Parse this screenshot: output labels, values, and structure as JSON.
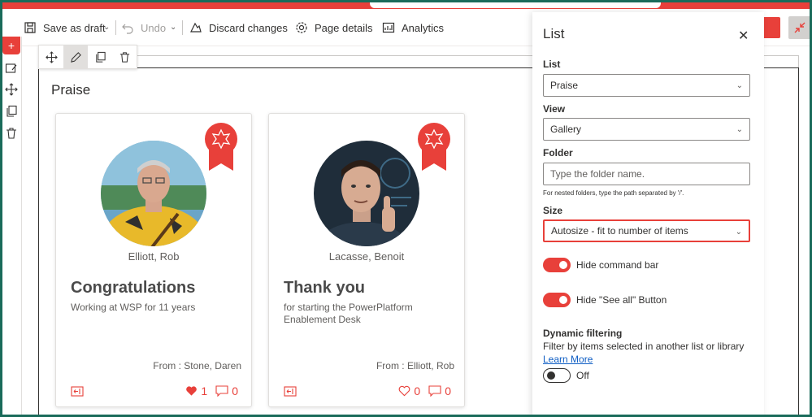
{
  "toolbar": {
    "save_draft": "Save as draft",
    "undo": "Undo",
    "discard": "Discard changes",
    "page_details": "Page details",
    "analytics": "Analytics"
  },
  "webpart": {
    "title": "Praise"
  },
  "cards": [
    {
      "name": "Elliott, Rob",
      "title": "Congratulations",
      "description": "Working at WSP for 11 years",
      "from": "From : Stone, Daren",
      "likes": "1",
      "comments": "0",
      "liked": true
    },
    {
      "name": "Lacasse, Benoit",
      "title": "Thank you",
      "description": "for starting the PowerPlatform Enablement Desk",
      "from": "From : Elliott, Rob",
      "likes": "0",
      "comments": "0",
      "liked": false
    }
  ],
  "panel": {
    "title": "List",
    "list_label": "List",
    "list_value": "Praise",
    "view_label": "View",
    "view_value": "Gallery",
    "folder_label": "Folder",
    "folder_placeholder": "Type the folder name.",
    "folder_hint": "For nested folders, type the path separated by '/'.",
    "size_label": "Size",
    "size_value": "Autosize - fit to number of items",
    "hide_command_bar": "Hide command bar",
    "hide_see_all": "Hide \"See all\" Button",
    "dynamic_filtering_label": "Dynamic filtering",
    "dynamic_filtering_desc": "Filter by items selected in another list or library",
    "learn_more": "Learn More",
    "dynamic_state": "Off"
  },
  "colors": {
    "accent": "#e8403a",
    "frame": "#1a6b5a",
    "link": "#0f5ec4"
  }
}
